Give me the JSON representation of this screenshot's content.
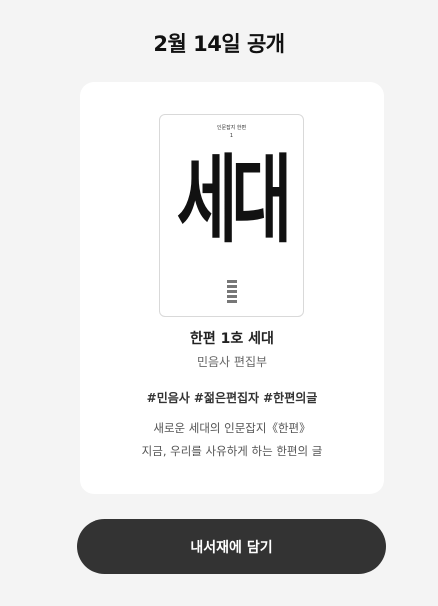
{
  "header": {
    "title": "2월 14일 공개"
  },
  "book": {
    "cover": {
      "series": "인문잡지 한편",
      "issue": "1",
      "title": "세대",
      "spine_text": "세대"
    },
    "title": "한편 1호 세대",
    "publisher": "민음사 편집부",
    "tags": [
      "#민음사",
      "#젊은편집자",
      "#한편의글"
    ],
    "description": [
      "새로운 세대의 인문잡지《한편》",
      "지금, 우리를 사유하게 하는 한편의 글"
    ]
  },
  "cta": {
    "label": "내서재에 담기"
  },
  "colors": {
    "background": "#f4f4f4",
    "card": "#ffffff",
    "button": "#333333",
    "button_text": "#ffffff"
  }
}
